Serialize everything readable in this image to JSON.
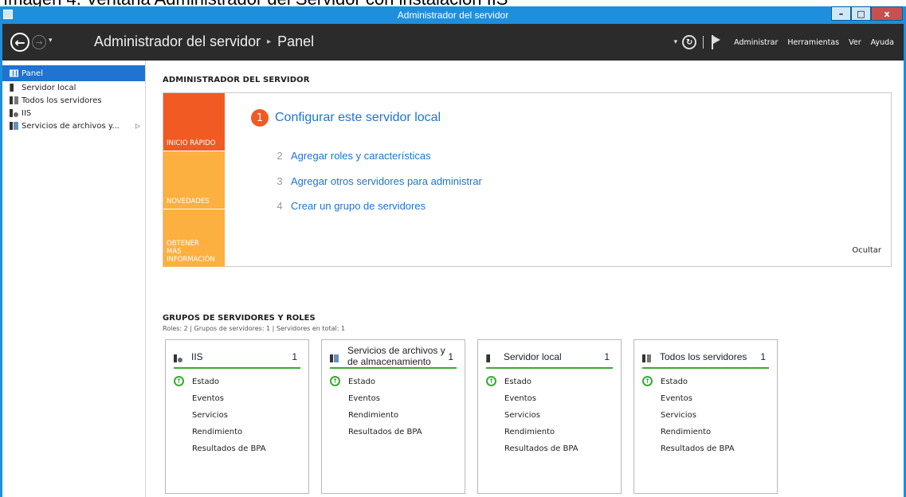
{
  "caption": "Imagen 4. Ventana Administrador del Servidor con instalación IIS",
  "window": {
    "title": "Administrador del servidor",
    "minimize": "–",
    "maximize": "□",
    "close": "x"
  },
  "header": {
    "breadcrumb_root": "Administrador del servidor",
    "breadcrumb_sep": "▸",
    "breadcrumb_current": "Panel",
    "menus": [
      "Administrar",
      "Herramientas",
      "Ver",
      "Ayuda"
    ]
  },
  "sidebar": {
    "items": [
      {
        "label": "Panel",
        "icon": "dashboard-icon"
      },
      {
        "label": "Servidor local",
        "icon": "server-icon"
      },
      {
        "label": "Todos los servidores",
        "icon": "servers-icon"
      },
      {
        "label": "IIS",
        "icon": "iis-icon"
      },
      {
        "label": "Servicios de archivos y...",
        "icon": "file-services-icon"
      }
    ]
  },
  "main": {
    "title": "ADMINISTRADOR DEL SERVIDOR",
    "welcome": {
      "tiles": [
        "INICIO RÁPIDO",
        "NOVEDADES",
        "OBTENER MÁS INFORMACIÓN"
      ],
      "primary_step": {
        "num": "1",
        "label": "Configurar este servidor local"
      },
      "steps": [
        {
          "num": "2",
          "label": "Agregar roles y características"
        },
        {
          "num": "3",
          "label": "Agregar otros servidores para administrar"
        },
        {
          "num": "4",
          "label": "Crear un grupo de servidores"
        }
      ],
      "hide": "Ocultar"
    },
    "groups": {
      "title": "GRUPOS DE SERVIDORES Y ROLES",
      "subtitle": "Roles: 2  |  Grupos de servidores: 1  |  Servidores en total: 1",
      "cards": [
        {
          "title": "IIS",
          "count": "1",
          "rows": [
            "Estado",
            "Eventos",
            "Servicios",
            "Rendimiento",
            "Resultados de BPA"
          ]
        },
        {
          "title": "Servicios de archivos y de almacenamiento",
          "count": "1",
          "rows": [
            "Estado",
            "Eventos",
            "Rendimiento",
            "Resultados de BPA"
          ]
        },
        {
          "title": "Servidor local",
          "count": "1",
          "rows": [
            "Estado",
            "Eventos",
            "Servicios",
            "Rendimiento",
            "Resultados de BPA"
          ]
        },
        {
          "title": "Todos los servidores",
          "count": "1",
          "rows": [
            "Estado",
            "Eventos",
            "Servicios",
            "Rendimiento",
            "Resultados de BPA"
          ]
        }
      ]
    }
  },
  "colors": {
    "accent": "#1e74d0",
    "quickstart": "#f15a22",
    "tile": "#fcb040",
    "status_ok": "#3aa935"
  }
}
